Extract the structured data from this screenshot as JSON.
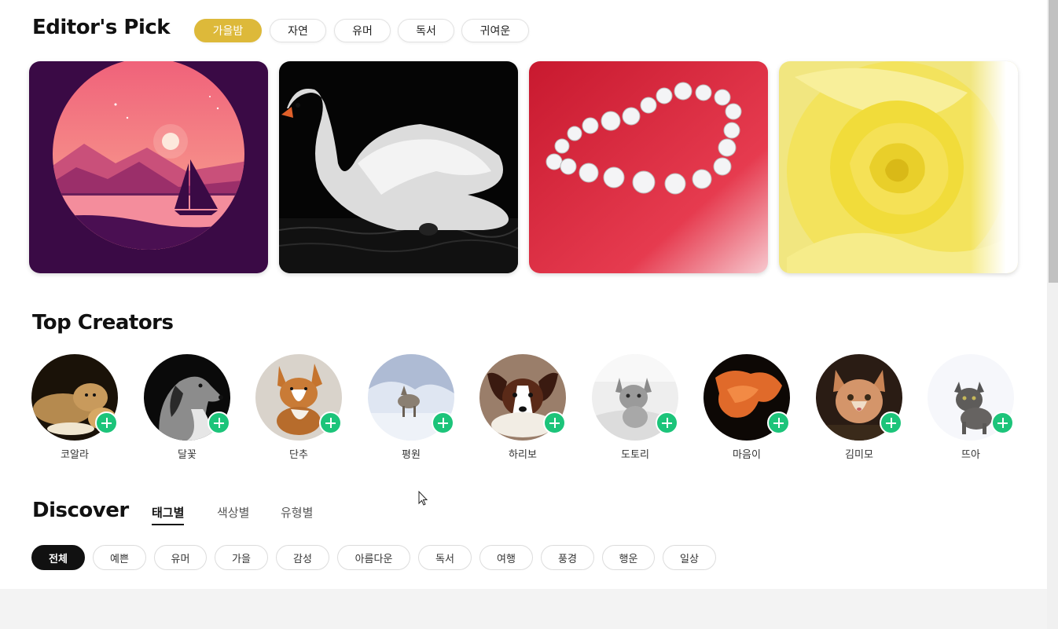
{
  "editors_pick": {
    "title": "Editor's Pick",
    "filters": [
      {
        "label": "가을밤",
        "active": true
      },
      {
        "label": "자연",
        "active": false
      },
      {
        "label": "유머",
        "active": false
      },
      {
        "label": "독서",
        "active": false
      },
      {
        "label": "귀여운",
        "active": false
      }
    ],
    "cards": [
      "sunset-lake-illustration",
      "white-swan-photo",
      "diamond-heart-photo",
      "yellow-rose-photo"
    ]
  },
  "top_creators": {
    "title": "Top Creators",
    "creators": [
      {
        "name": "코알라"
      },
      {
        "name": "달꽃"
      },
      {
        "name": "단추"
      },
      {
        "name": "평원"
      },
      {
        "name": "하리보"
      },
      {
        "name": "도토리"
      },
      {
        "name": "마음이"
      },
      {
        "name": "김미모"
      },
      {
        "name": "뜨아"
      }
    ]
  },
  "discover": {
    "title": "Discover",
    "tabs": [
      {
        "label": "태그별",
        "active": true
      },
      {
        "label": "색상별",
        "active": false
      },
      {
        "label": "유형별",
        "active": false
      }
    ],
    "tags": [
      {
        "label": "전체",
        "active": true
      },
      {
        "label": "예쁜",
        "active": false
      },
      {
        "label": "유머",
        "active": false
      },
      {
        "label": "가을",
        "active": false
      },
      {
        "label": "감성",
        "active": false
      },
      {
        "label": "아름다운",
        "active": false
      },
      {
        "label": "독서",
        "active": false
      },
      {
        "label": "여행",
        "active": false
      },
      {
        "label": "풍경",
        "active": false
      },
      {
        "label": "행운",
        "active": false
      },
      {
        "label": "일상",
        "active": false
      }
    ]
  },
  "colors": {
    "accent": "#ddb93a",
    "follow": "#1cc47a",
    "active_tag": "#111111"
  }
}
